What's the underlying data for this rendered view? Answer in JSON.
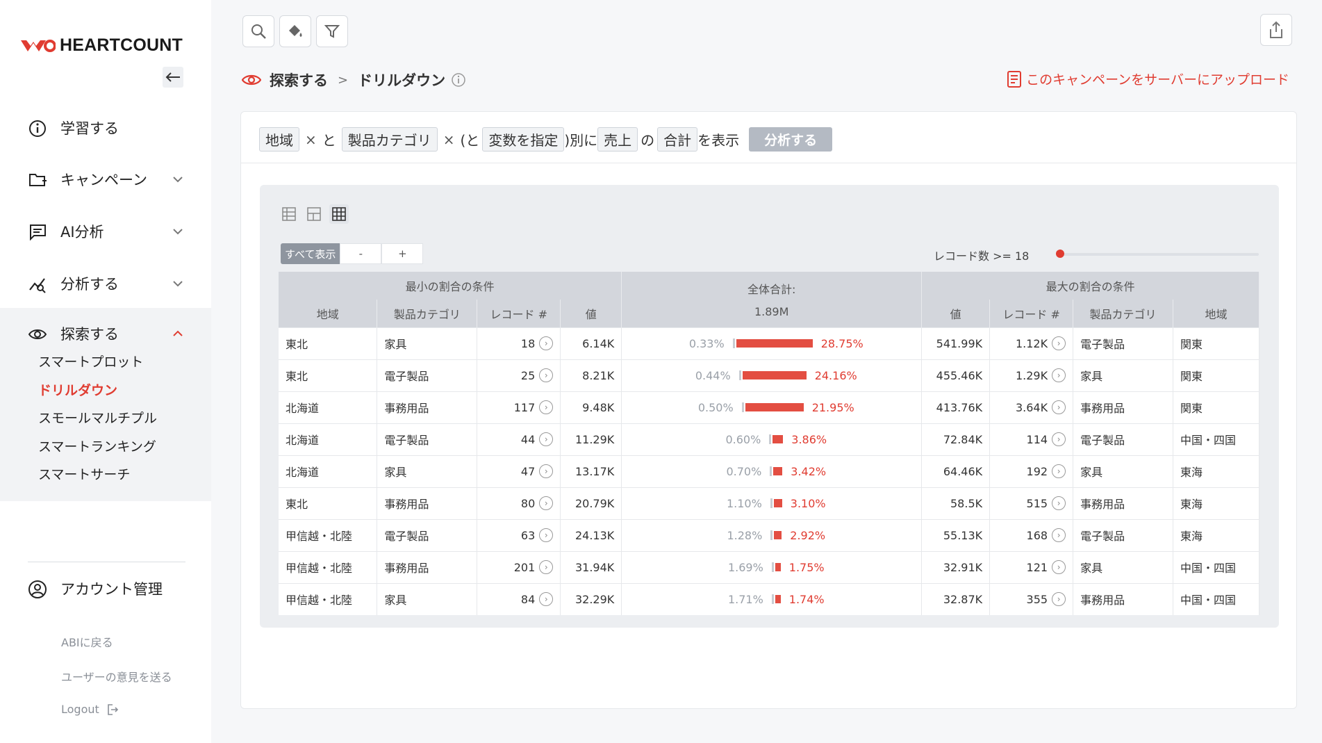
{
  "app": {
    "logo_text": "HEARTCOUNT",
    "accent": "#e03c31"
  },
  "sidebar": {
    "items": [
      {
        "label": "学習する",
        "icon": "info-icon"
      },
      {
        "label": "キャンペーン",
        "icon": "folder-plus-icon"
      },
      {
        "label": "AI分析",
        "icon": "chat-icon"
      },
      {
        "label": "分析する",
        "icon": "analytics-icon"
      },
      {
        "label": "探索する",
        "icon": "eye-icon"
      }
    ],
    "explore_sub": [
      "スマートプロット",
      "ドリルダウン",
      "スモールマルチプル",
      "スマートランキング",
      "スマートサーチ"
    ],
    "account": "アカウント管理",
    "footer": {
      "back": "ABIに戻る",
      "feedback": "ユーザーの意見を送る",
      "logout": "Logout"
    }
  },
  "breadcrumb": {
    "section": "探索する",
    "sep": ">",
    "page": "ドリルダウン"
  },
  "upload_label": "このキャンペーンをサーバーにアップロード",
  "query": {
    "chip1": "地域",
    "x": "×",
    "to": "と",
    "chip2": "製品カテゴリ",
    "paren_to": "(と",
    "chip3": "変数を指定",
    "betsu": ")別に",
    "chip4": "売上",
    "no": "の",
    "chip5": "合計",
    "hyouji": "を表示",
    "analyze": "分析する"
  },
  "controls": {
    "show_all": "すべて表示",
    "minus": "-",
    "plus": "+",
    "record_filter": "レコード数 >=  18"
  },
  "table": {
    "group_min": "最小の割合の条件",
    "group_total": "全体合計:",
    "group_max": "最大の割合の条件",
    "total_value": "1.89M",
    "headers_min": [
      "地域",
      "製品カテゴリ",
      "レコード #",
      "値"
    ],
    "headers_max": [
      "値",
      "レコード #",
      "製品カテゴリ",
      "地域"
    ],
    "rows": [
      {
        "r1": "東北",
        "c1": "家具",
        "n1": "18",
        "v1": "6.14K",
        "pmin": "0.33%",
        "pmax": "28.75%",
        "share": 28.75,
        "v2": "541.99K",
        "n2": "1.12K",
        "c2": "電子製品",
        "r2": "関東"
      },
      {
        "r1": "東北",
        "c1": "電子製品",
        "n1": "25",
        "v1": "8.21K",
        "pmin": "0.44%",
        "pmax": "24.16%",
        "share": 24.16,
        "v2": "455.46K",
        "n2": "1.29K",
        "c2": "家具",
        "r2": "関東"
      },
      {
        "r1": "北海道",
        "c1": "事務用品",
        "n1": "117",
        "v1": "9.48K",
        "pmin": "0.50%",
        "pmax": "21.95%",
        "share": 21.95,
        "v2": "413.76K",
        "n2": "3.64K",
        "c2": "事務用品",
        "r2": "関東"
      },
      {
        "r1": "北海道",
        "c1": "電子製品",
        "n1": "44",
        "v1": "11.29K",
        "pmin": "0.60%",
        "pmax": "3.86%",
        "share": 3.86,
        "v2": "72.84K",
        "n2": "114",
        "c2": "電子製品",
        "r2": "中国・四国"
      },
      {
        "r1": "北海道",
        "c1": "家具",
        "n1": "47",
        "v1": "13.17K",
        "pmin": "0.70%",
        "pmax": "3.42%",
        "share": 3.42,
        "v2": "64.46K",
        "n2": "192",
        "c2": "家具",
        "r2": "東海"
      },
      {
        "r1": "東北",
        "c1": "事務用品",
        "n1": "80",
        "v1": "20.79K",
        "pmin": "1.10%",
        "pmax": "3.10%",
        "share": 3.1,
        "v2": "58.5K",
        "n2": "515",
        "c2": "事務用品",
        "r2": "東海"
      },
      {
        "r1": "甲信越・北陸",
        "c1": "電子製品",
        "n1": "63",
        "v1": "24.13K",
        "pmin": "1.28%",
        "pmax": "2.92%",
        "share": 2.92,
        "v2": "55.13K",
        "n2": "168",
        "c2": "電子製品",
        "r2": "東海"
      },
      {
        "r1": "甲信越・北陸",
        "c1": "事務用品",
        "n1": "201",
        "v1": "31.94K",
        "pmin": "1.69%",
        "pmax": "1.75%",
        "share": 1.75,
        "v2": "32.91K",
        "n2": "121",
        "c2": "家具",
        "r2": "中国・四国"
      },
      {
        "r1": "甲信越・北陸",
        "c1": "家具",
        "n1": "84",
        "v1": "32.29K",
        "pmin": "1.71%",
        "pmax": "1.74%",
        "share": 1.74,
        "v2": "32.87K",
        "n2": "355",
        "c2": "事務用品",
        "r2": "中国・四国"
      }
    ]
  }
}
